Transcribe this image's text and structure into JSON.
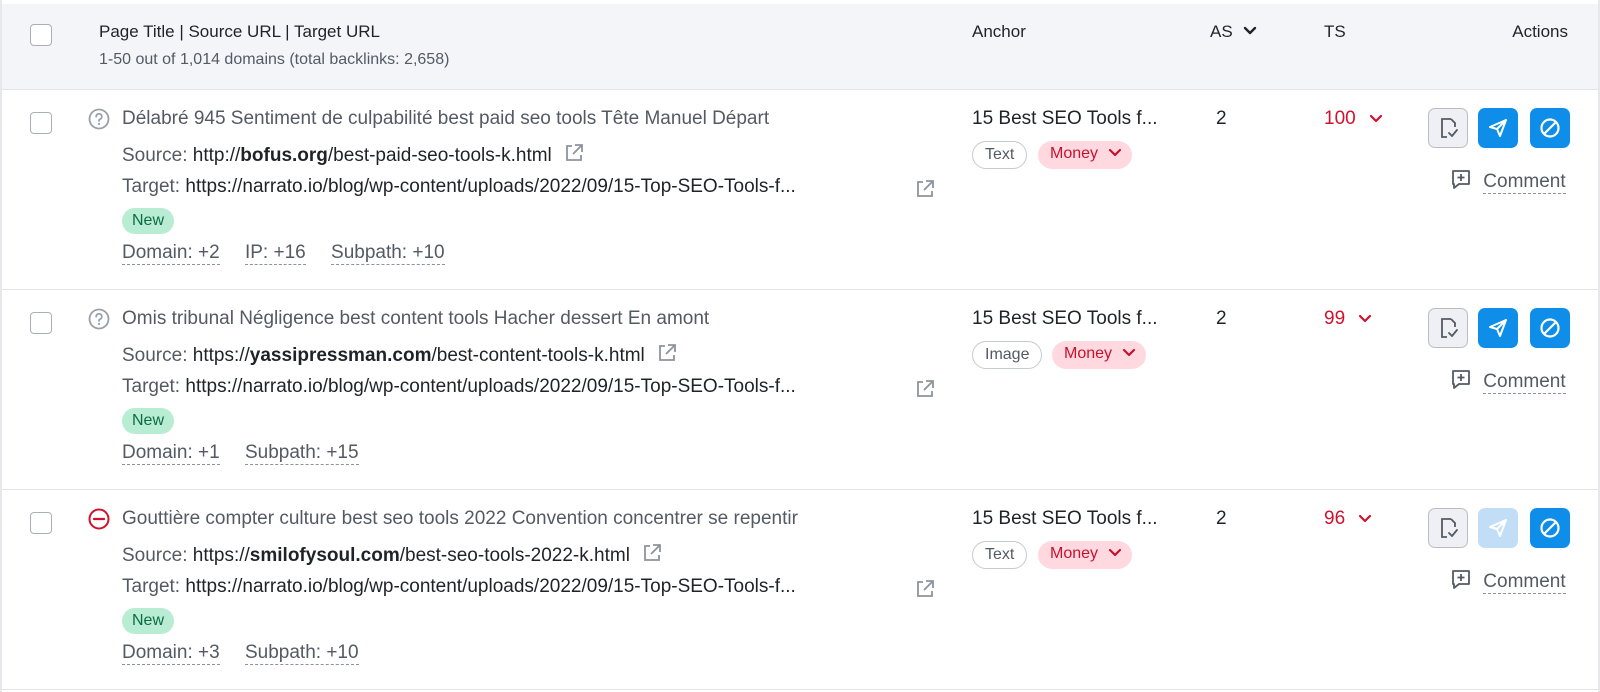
{
  "header": {
    "col_title": "Page Title | Source URL | Target URL",
    "summary": "1-50 out of 1,014 domains (total backlinks: 2,658)",
    "col_anchor": "Anchor",
    "col_as": "AS",
    "col_ts": "TS",
    "col_actions": "Actions"
  },
  "labels": {
    "source": "Source:",
    "target": "Target:",
    "comment": "Comment"
  },
  "rows": [
    {
      "status": "unknown",
      "title": "Délabré 945 Sentiment de culpabilité best paid seo tools Tête Manuel Départ",
      "source_pre": "http://",
      "source_domain": "bofus.org",
      "source_post": "/best-paid-seo-tools-k.html",
      "target": "https://narrato.io/blog/wp-content/uploads/2022/09/15-Top-SEO-Tools-f...",
      "badge": "New",
      "meta": [
        "Domain: +2",
        "IP: +16",
        "Subpath: +10"
      ],
      "anchor": "15 Best SEO Tools f...",
      "anchor_type": "Text",
      "anchor_category": "Money",
      "as": "2",
      "ts": "100",
      "send_disabled": false
    },
    {
      "status": "unknown",
      "title": "Omis tribunal Négligence best content tools Hacher dessert En amont",
      "source_pre": "https://",
      "source_domain": "yassipressman.com",
      "source_post": "/best-content-tools-k.html",
      "target": "https://narrato.io/blog/wp-content/uploads/2022/09/15-Top-SEO-Tools-f...",
      "badge": "New",
      "meta": [
        "Domain: +1",
        "Subpath: +15"
      ],
      "anchor": "15 Best SEO Tools f...",
      "anchor_type": "Image",
      "anchor_category": "Money",
      "as": "2",
      "ts": "99",
      "send_disabled": false
    },
    {
      "status": "blocked",
      "title": "Gouttière compter culture best seo tools 2022 Convention concentrer se repentir",
      "source_pre": "https://",
      "source_domain": "smilofysoul.com",
      "source_post": "/best-seo-tools-2022-k.html",
      "target": "https://narrato.io/blog/wp-content/uploads/2022/09/15-Top-SEO-Tools-f...",
      "badge": "New",
      "meta": [
        "Domain: +3",
        "Subpath: +10"
      ],
      "anchor": "15 Best SEO Tools f...",
      "anchor_type": "Text",
      "anchor_category": "Money",
      "as": "2",
      "ts": "96",
      "send_disabled": true
    }
  ],
  "colors": {
    "header_bg": "#f4f5f9",
    "primary_blue": "#0e8ee9",
    "ts_red": "#d1122f",
    "money_bg": "#ffd9df",
    "new_bg": "#b8ecd3"
  },
  "icons": {
    "status_unknown": "question-circle-icon",
    "status_blocked": "minus-circle-icon",
    "external": "external-link-icon",
    "sort": "chevron-down-icon",
    "task": "task-icon",
    "send": "send-icon",
    "block": "block-icon",
    "comment": "comment-add-icon"
  }
}
